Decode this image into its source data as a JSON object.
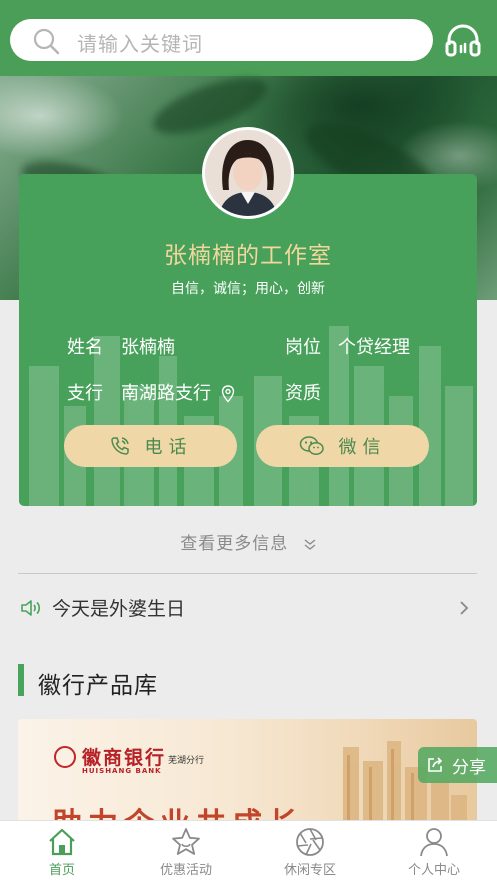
{
  "search": {
    "placeholder": "请输入关键词"
  },
  "profile": {
    "studio_title": "张楠楠的工作室",
    "motto": "自信，诚信；用心，创新",
    "name_label": "姓名",
    "name_value": "张楠楠",
    "position_label": "岗位",
    "position_value": "个贷经理",
    "branch_label": "支行",
    "branch_value": "南湖路支行",
    "qualification_label": "资质",
    "phone_button": "电话",
    "wechat_button": "微信"
  },
  "more_info": "查看更多信息",
  "notice": {
    "text": "今天是外婆生日"
  },
  "section": {
    "title": "徽行产品库"
  },
  "product_banner": {
    "bank_name": "徽商银行",
    "bank_name_en": "HUISHANG BANK",
    "branch": "芜湖分行",
    "slogan": "助力企业共成长"
  },
  "share_label": "分享",
  "tabs": [
    {
      "label": "首页",
      "icon": "home-icon",
      "active": true
    },
    {
      "label": "优惠活动",
      "icon": "star-icon",
      "active": false
    },
    {
      "label": "休闲专区",
      "icon": "aperture-icon",
      "active": false
    },
    {
      "label": "个人中心",
      "icon": "user-icon",
      "active": false
    }
  ],
  "colors": {
    "brand_green": "#4a9e58",
    "card_green": "#47a15a",
    "gold": "#f0d7a8",
    "title_gold": "#f2d79e"
  }
}
